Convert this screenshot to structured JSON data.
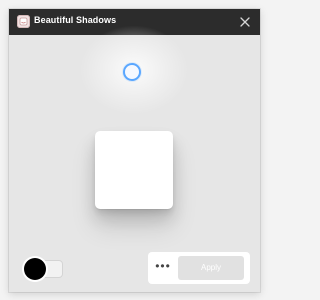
{
  "window": {
    "title": "Beautiful Shadows",
    "app_icon": "app-logo-icon",
    "close_icon": "close-icon"
  },
  "canvas": {
    "background_color": "#e6e6e6",
    "light_handle_color": "#5aa7ff",
    "preview_box_color": "#ffffff"
  },
  "controls": {
    "shadow_color": "#000000",
    "more_label": "•••",
    "apply_label": "Apply",
    "apply_enabled": false
  }
}
